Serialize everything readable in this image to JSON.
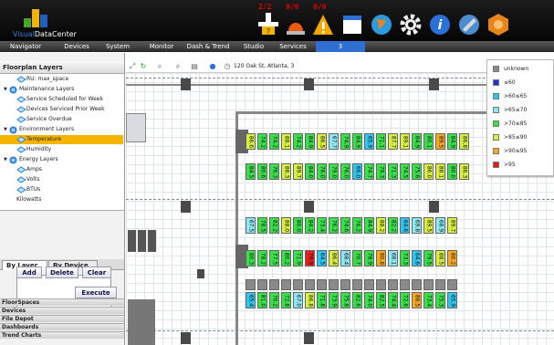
{
  "app": {
    "brand_prefix": "Visual",
    "brand_name": "DataCenter",
    "colors": {
      "brand_green": "#4aa32a",
      "brand_yellow": "#f2b400",
      "brand_blue": "#1f5fbf",
      "nav_active": "#2f6fd1",
      "selection": "#f5b400"
    }
  },
  "alerts": [
    {
      "text": "2/2",
      "icon": "power-warning-icon"
    },
    {
      "text": "0/0",
      "icon": "beacon-alarm-icon"
    },
    {
      "text": "0/0",
      "icon": "warning-triangle-icon"
    }
  ],
  "toolbar_icons": [
    "calendar-icon",
    "globe-icon",
    "gear-icon",
    "info-icon",
    "satellite-icon",
    "hexagon-icon"
  ],
  "nav": [
    "Navigator",
    "Devices",
    "System",
    "Monitor",
    "Dash & Trend",
    "Studio",
    "Services",
    "3"
  ],
  "sidebar": {
    "title": "Floorplan Layers",
    "tree": [
      {
        "label": "RU: max_space",
        "level": 2,
        "icon": "diamond"
      },
      {
        "label": "Maintenance Layers",
        "level": 0,
        "icon": "globe",
        "toggle": "▼"
      },
      {
        "label": "Service Scheduled for Week",
        "level": 1,
        "icon": "diamond"
      },
      {
        "label": "Devices Serviced Prior Week",
        "level": 1,
        "icon": "diamond"
      },
      {
        "label": "Service Overdue",
        "level": 1,
        "icon": "diamond"
      },
      {
        "label": "Environment Layers",
        "level": 0,
        "icon": "globe",
        "toggle": "▼"
      },
      {
        "label": "Temperature",
        "level": 1,
        "icon": "diamond",
        "selected": true
      },
      {
        "label": "Humidity",
        "level": 1,
        "icon": "diamond"
      },
      {
        "label": "Energy Layers",
        "level": 0,
        "icon": "globe",
        "toggle": "▼"
      },
      {
        "label": "Amps",
        "level": 1,
        "icon": "diamond"
      },
      {
        "label": "Volts",
        "level": 1,
        "icon": "diamond"
      },
      {
        "label": "BTUs",
        "level": 1,
        "icon": "diamond"
      },
      {
        "label": "Kilowatts",
        "level": 1,
        "icon": "none"
      }
    ],
    "tabs": [
      "By Layer",
      "By Device"
    ],
    "buttons": {
      "add": "Add",
      "delete": "Delete",
      "clear": "Clear",
      "execute": "Execute"
    },
    "accordion": [
      "FloorSpaces",
      "Devices",
      "File Depot",
      "Dashboards",
      "Trend Charts"
    ]
  },
  "floor": {
    "address": "120 Oak St, Atlanta, 3"
  },
  "legend": [
    {
      "label": "unknown",
      "color": "#8a8a8a"
    },
    {
      "label": "≤60",
      "color": "#2b2bd6"
    },
    {
      "label": ">60≤65",
      "color": "#2ec6f0"
    },
    {
      "label": ">65≤70",
      "color": "#8ee8f4"
    },
    {
      "label": ">70≤85",
      "color": "#39e04a"
    },
    {
      "label": ">85≤90",
      "color": "#d8ef42"
    },
    {
      "label": ">90≤95",
      "color": "#f5a820"
    },
    {
      "label": ">95",
      "color": "#e81e1e"
    }
  ],
  "racks": [
    {
      "row": "r1",
      "cells": [
        [
          "86.6",
          "#d8ef42"
        ],
        [
          "74.2",
          "#39e04a"
        ],
        [
          "74.2",
          "#39e04a"
        ],
        [
          "88.1",
          "#d8ef42"
        ],
        [
          "74.2",
          "#39e04a"
        ],
        [
          "84.9",
          "#39e04a"
        ],
        [
          "86.5",
          "#d8ef42"
        ],
        [
          "67.7",
          "#8ee8f4"
        ],
        [
          "74.9",
          "#39e04a"
        ],
        [
          "84.9",
          "#39e04a"
        ],
        [
          "65.9",
          "#2ec6f0"
        ],
        [
          "71.1",
          "#39e04a"
        ],
        [
          "87.7",
          "#d8ef42"
        ],
        [
          "89.1",
          "#d8ef42"
        ],
        [
          "84.9",
          "#39e04a"
        ],
        [
          "80.1",
          "#39e04a"
        ],
        [
          "89.5",
          "#f5a820"
        ],
        [
          "84.9",
          "#39e04a"
        ],
        [
          "86.8",
          "#d8ef42"
        ]
      ]
    },
    {
      "row": "r2",
      "cells": [
        [
          "84.5",
          "#39e04a"
        ],
        [
          "80.6",
          "#39e04a"
        ],
        [
          "76.3",
          "#39e04a"
        ],
        [
          "88.3",
          "#d8ef42"
        ],
        [
          "89.7",
          "#d8ef42"
        ],
        [
          "84.0",
          "#39e04a"
        ],
        [
          "76.0",
          "#39e04a"
        ],
        [
          "79.0",
          "#39e04a"
        ],
        [
          "76.0",
          "#39e04a"
        ],
        [
          "66.0",
          "#2ec6f0"
        ],
        [
          "74.7",
          "#39e04a"
        ],
        [
          "79.3",
          "#39e04a"
        ],
        [
          "71.3",
          "#39e04a"
        ],
        [
          "74.5",
          "#39e04a"
        ],
        [
          "75.6",
          "#39e04a"
        ],
        [
          "86.0",
          "#d8ef42"
        ],
        [
          "88.1",
          "#d8ef42"
        ],
        [
          "80.0",
          "#39e04a"
        ],
        [
          "86.3",
          "#d8ef42"
        ]
      ]
    },
    {
      "row": "r3",
      "cells": [
        [
          "67.5",
          "#8ee8f4"
        ],
        [
          "78.5",
          "#39e04a"
        ],
        [
          "82.2",
          "#39e04a"
        ],
        [
          "88.0",
          "#d8ef42"
        ],
        [
          "80.0",
          "#39e04a"
        ],
        [
          "84.2",
          "#39e04a"
        ],
        [
          "73.4",
          "#39e04a"
        ],
        [
          "76.2",
          "#39e04a"
        ],
        [
          "74.6",
          "#39e04a"
        ],
        [
          "76.2",
          "#39e04a"
        ],
        [
          "84.9",
          "#39e04a"
        ],
        [
          "88.2",
          "#d8ef42"
        ],
        [
          "82.2",
          "#39e04a"
        ],
        [
          "64.6",
          "#2ec6f0"
        ],
        [
          "69.8",
          "#8ee8f4"
        ],
        [
          "89.5",
          "#d8ef42"
        ],
        [
          "68.9",
          "#8ee8f4"
        ],
        [
          "89.7",
          "#d8ef42"
        ]
      ]
    },
    {
      "row": "r4",
      "cells": [
        [
          "80.3",
          "#39e04a"
        ],
        [
          "78.2",
          "#39e04a"
        ],
        [
          "77.5",
          "#39e04a"
        ],
        [
          "80.2",
          "#39e04a"
        ],
        [
          "71.9",
          "#39e04a"
        ],
        [
          "79.9",
          "#e81e1e"
        ],
        [
          "64.5",
          "#2ec6f0"
        ],
        [
          "86.4",
          "#d8ef42"
        ],
        [
          "68.4",
          "#8ee8f4"
        ],
        [
          "70.7",
          "#39e04a"
        ],
        [
          "78.9",
          "#39e04a"
        ],
        [
          "90.8",
          "#f5a820"
        ],
        [
          "68.1",
          "#8ee8f4"
        ],
        [
          "73.3",
          "#39e04a"
        ],
        [
          "64.6",
          "#2ec6f0"
        ],
        [
          "79.5",
          "#39e04a"
        ],
        [
          "88.5",
          "#d8ef42"
        ],
        [
          "80.2",
          "#f5a820"
        ]
      ]
    },
    {
      "row": "r5",
      "cells": [
        [
          "65.4",
          "#2ec6f0"
        ],
        [
          "81.0",
          "#39e04a"
        ],
        [
          "70.2",
          "#39e04a"
        ],
        [
          "72.8",
          "#39e04a"
        ],
        [
          "67.0",
          "#8ee8f4"
        ],
        [
          "86.8",
          "#d8ef42"
        ],
        [
          "71.8",
          "#39e04a"
        ],
        [
          "73.9",
          "#39e04a"
        ],
        [
          "75.8",
          "#39e04a"
        ],
        [
          "82.6",
          "#39e04a"
        ],
        [
          "74.0",
          "#39e04a"
        ],
        [
          "82.5",
          "#39e04a"
        ],
        [
          "74.4",
          "#39e04a"
        ],
        [
          "72.6",
          "#39e04a"
        ],
        [
          "88.5",
          "#f5a820"
        ],
        [
          "73.4",
          "#39e04a"
        ],
        [
          "75.3",
          "#39e04a"
        ],
        [
          "65.9",
          "#2ec6f0"
        ]
      ]
    }
  ]
}
